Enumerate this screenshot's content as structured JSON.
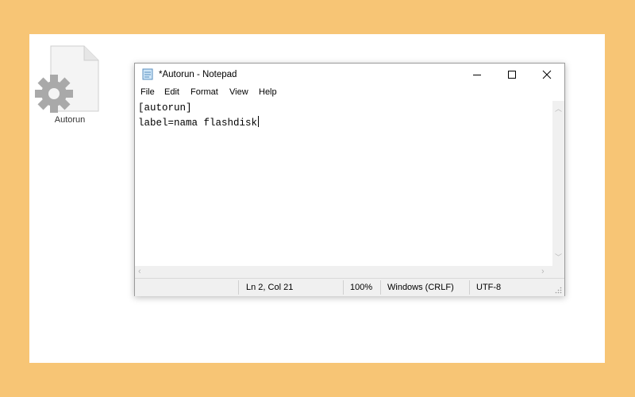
{
  "desktop": {
    "file_icon_label": "Autorun"
  },
  "window": {
    "title": "*Autorun - Notepad",
    "menu": [
      "File",
      "Edit",
      "Format",
      "View",
      "Help"
    ],
    "editor_lines": [
      "[autorun]",
      "label=nama flashdisk"
    ],
    "status": {
      "position": "Ln 2, Col 21",
      "zoom": "100%",
      "line_ending": "Windows (CRLF)",
      "encoding": "UTF-8"
    }
  },
  "colors": {
    "background": "#F7C575",
    "panel": "#FFFFFF",
    "statusbar": "#F0F0F0"
  }
}
